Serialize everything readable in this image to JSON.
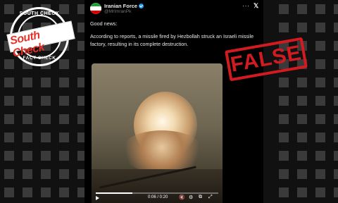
{
  "stamps": {
    "south_check_top": "SOUTH CHECK",
    "south_check_logo": "South Check",
    "south_check_bottom": "FACT-CHECK",
    "verdict": "FALSE"
  },
  "post": {
    "author_name": "Iranian Force",
    "author_handle": "@MrImranPk",
    "verified_icon": "verified-badge-icon",
    "more_icon": "more-dots-icon",
    "platform_icon": "x-logo-icon",
    "more_label": "···",
    "x_label": "𝕏",
    "line1": "Good news:",
    "line2": "According to reports, a missile fired by Hezbollah struck an Israeli missile factory, resulting in its complete destruction.",
    "video": {
      "time": "0:06 / 0:20",
      "progress": 0.3,
      "controls": {
        "play_icon": "play-icon",
        "mute_label": "🔇",
        "gear_label": "⚙",
        "fullscreen_label": "⤢",
        "pip_label": "⧉"
      }
    }
  },
  "colors": {
    "verdict_red": "#d21b20",
    "south_check_red": "#e4322b",
    "verified_blue": "#1d9bf0",
    "post_bg": "#000000"
  }
}
